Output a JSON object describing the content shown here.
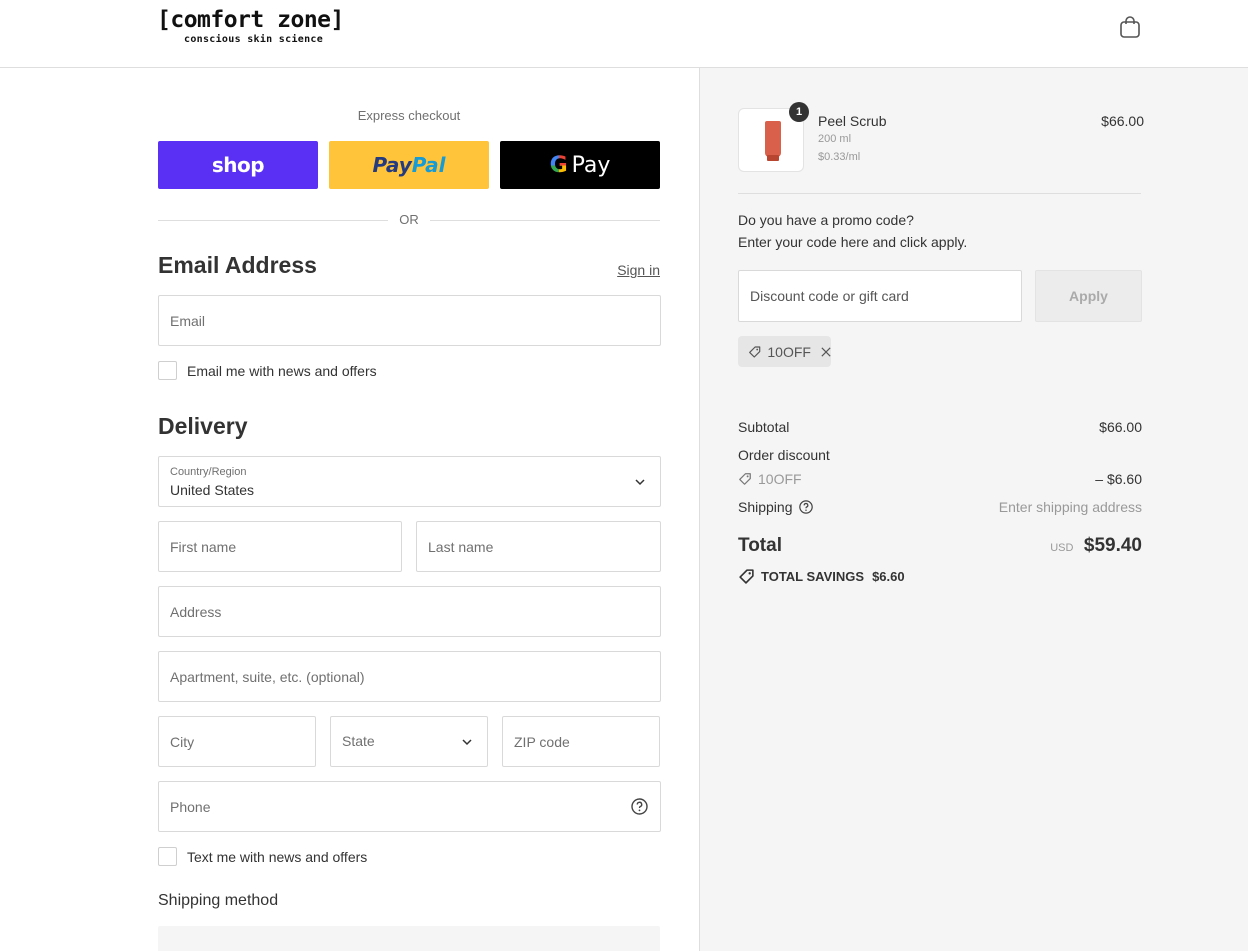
{
  "header": {
    "logo_main": "[comfort zone]",
    "logo_sub": "conscious skin science",
    "cart_icon": "shopping-bag-icon"
  },
  "express": {
    "label": "Express checkout",
    "shop_label": "shop",
    "paypal_part1": "Pay",
    "paypal_part2": "Pal",
    "gpay_g": "G",
    "gpay_label": "Pay",
    "or_label": "OR"
  },
  "contact": {
    "title": "Email Address",
    "sign_in": "Sign in",
    "email_placeholder": "Email",
    "newsletter_label": "Email me with news and offers"
  },
  "delivery": {
    "title": "Delivery",
    "country_label": "Country/Region",
    "country_value": "United States",
    "first_name": "First name",
    "last_name": "Last name",
    "address": "Address",
    "apartment": "Apartment, suite, etc. (optional)",
    "city": "City",
    "state": "State",
    "zip": "ZIP code",
    "phone": "Phone",
    "sms_label": "Text me with news and offers"
  },
  "shipping_method": {
    "title": "Shipping method"
  },
  "summary": {
    "product": {
      "name": "Peel Scrub",
      "size": "200 ml",
      "unit_price": "$0.33/ml",
      "price": "$66.00",
      "quantity": "1"
    },
    "promo_question": "Do you have a promo code?",
    "promo_hint": "Enter your code here and click apply.",
    "discount_placeholder": "Discount code or gift card",
    "apply_label": "Apply",
    "applied_code": "10OFF",
    "subtotal_label": "Subtotal",
    "subtotal_value": "$66.00",
    "order_discount_label": "Order discount",
    "discount_code": "10OFF",
    "discount_value": "– $6.60",
    "shipping_label": "Shipping",
    "shipping_value": "Enter shipping address",
    "total_label": "Total",
    "currency": "USD",
    "total_value": "$59.40",
    "savings_label": "TOTAL SAVINGS",
    "savings_value": "$6.60"
  },
  "colors": {
    "shop_purple": "#5a31f4",
    "paypal_yellow": "#ffc439",
    "gpay_black": "#000000",
    "summary_bg": "#f5f5f5"
  }
}
